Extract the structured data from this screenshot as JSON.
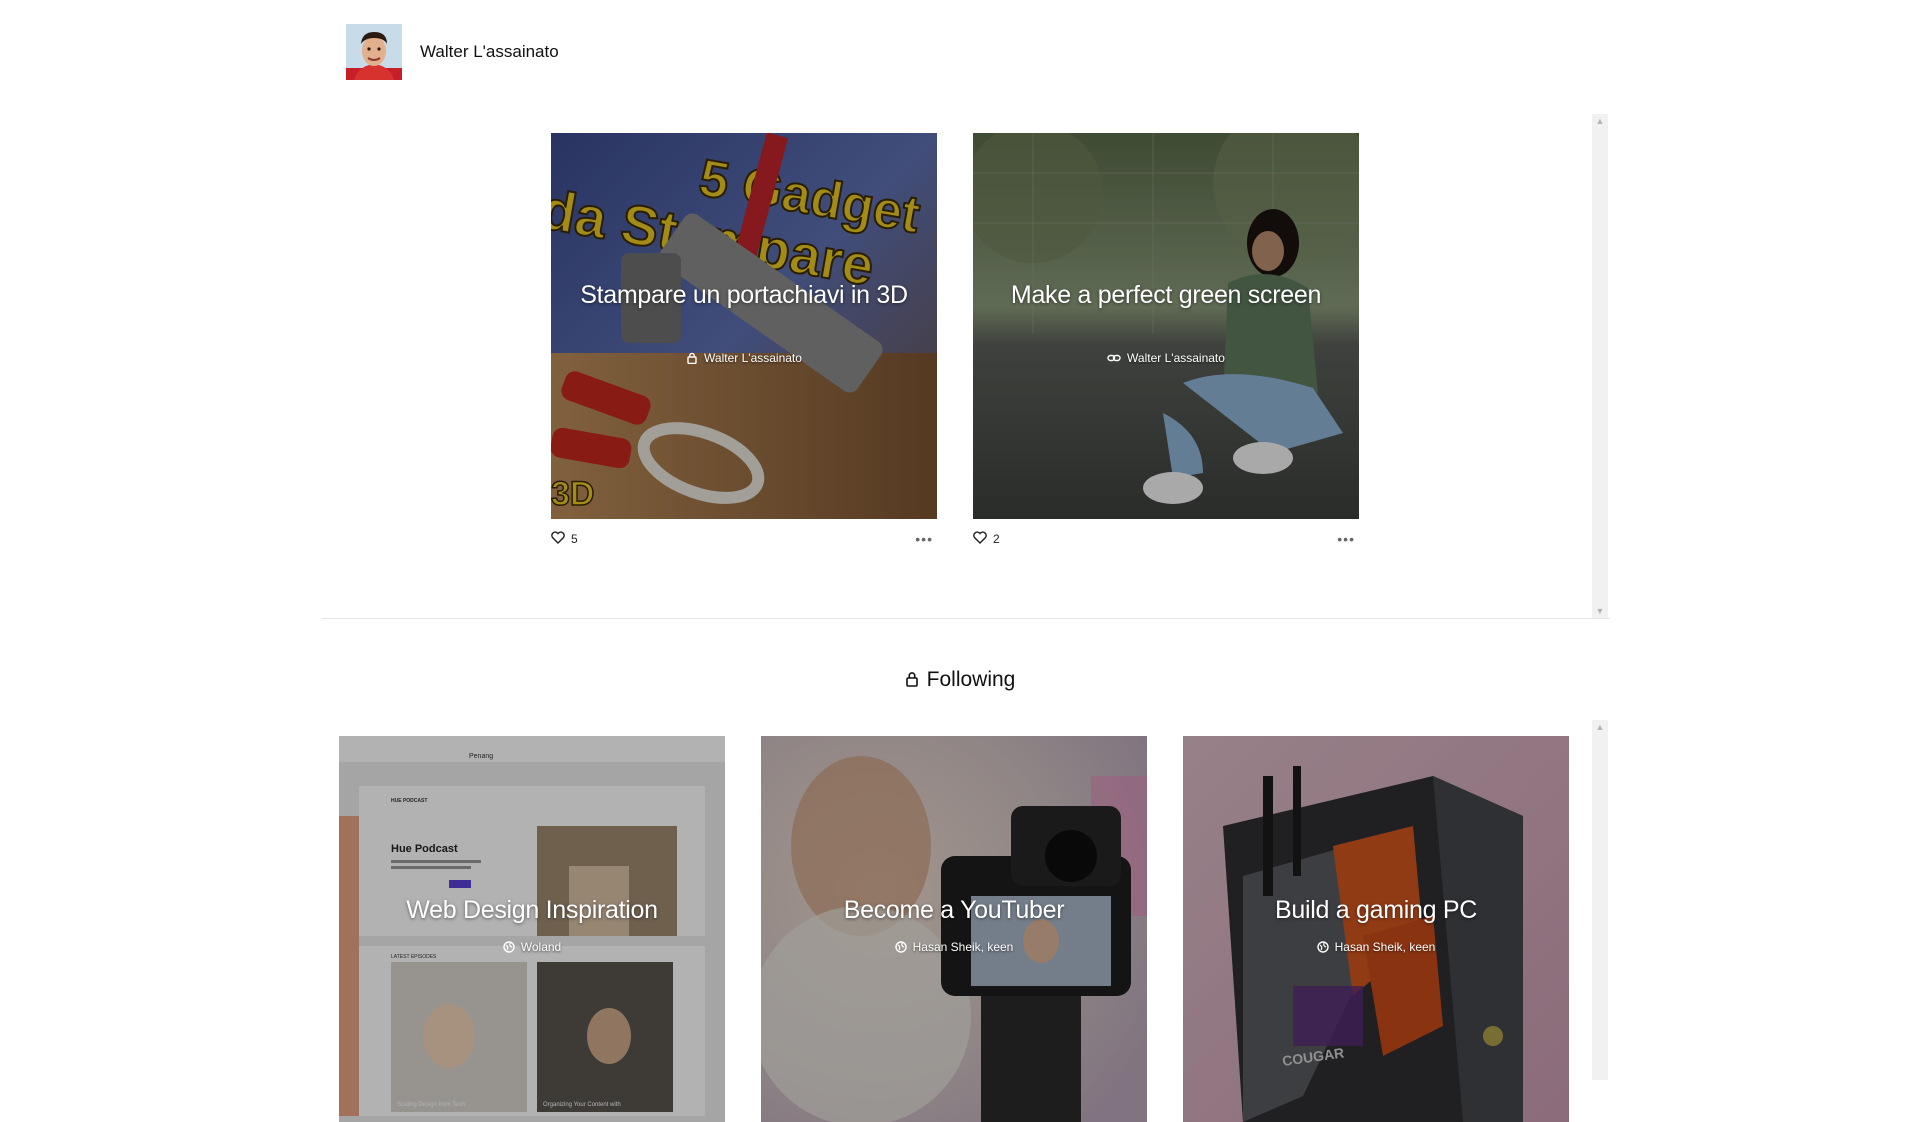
{
  "profile": {
    "name": "Walter L'assainato"
  },
  "my_boards": [
    {
      "title": "Stampare un portachiavi in 3D",
      "author": "Walter L'assainato",
      "visibility_icon": "lock-icon",
      "likes": "5"
    },
    {
      "title": "Make a perfect green screen",
      "author": "Walter L'assainato",
      "visibility_icon": "link-icon",
      "likes": "2"
    }
  ],
  "following": {
    "title": "Following",
    "icon": "lock-icon",
    "boards": [
      {
        "title": "Web Design Inspiration",
        "author": "Woland",
        "visibility_icon": "globe-icon"
      },
      {
        "title": "Become a YouTuber",
        "author": "Hasan Sheik, keen",
        "visibility_icon": "globe-icon"
      },
      {
        "title": "Build a gaming PC",
        "author": "Hasan Sheik, keen",
        "visibility_icon": "globe-icon"
      }
    ]
  },
  "thumb_text": {
    "gadget_line1": "5 Gadget",
    "gadget_line2": "da Stampare",
    "gadget_3d": "3D",
    "site_name": "Penang",
    "podcast_small": "HUE PODCAST",
    "podcast_heading": "Hue Podcast",
    "episodes_label": "LATEST EPISODES",
    "episode1_title": "Scaling Design from Tech",
    "episode2_title": "Organizing Your Content with",
    "pc_brand": "COUGAR"
  },
  "colors": {
    "accent": "#5b3fd6",
    "overlay": "rgba(0,0,0,0.30)",
    "scrollbar": "#f1f1f1"
  }
}
